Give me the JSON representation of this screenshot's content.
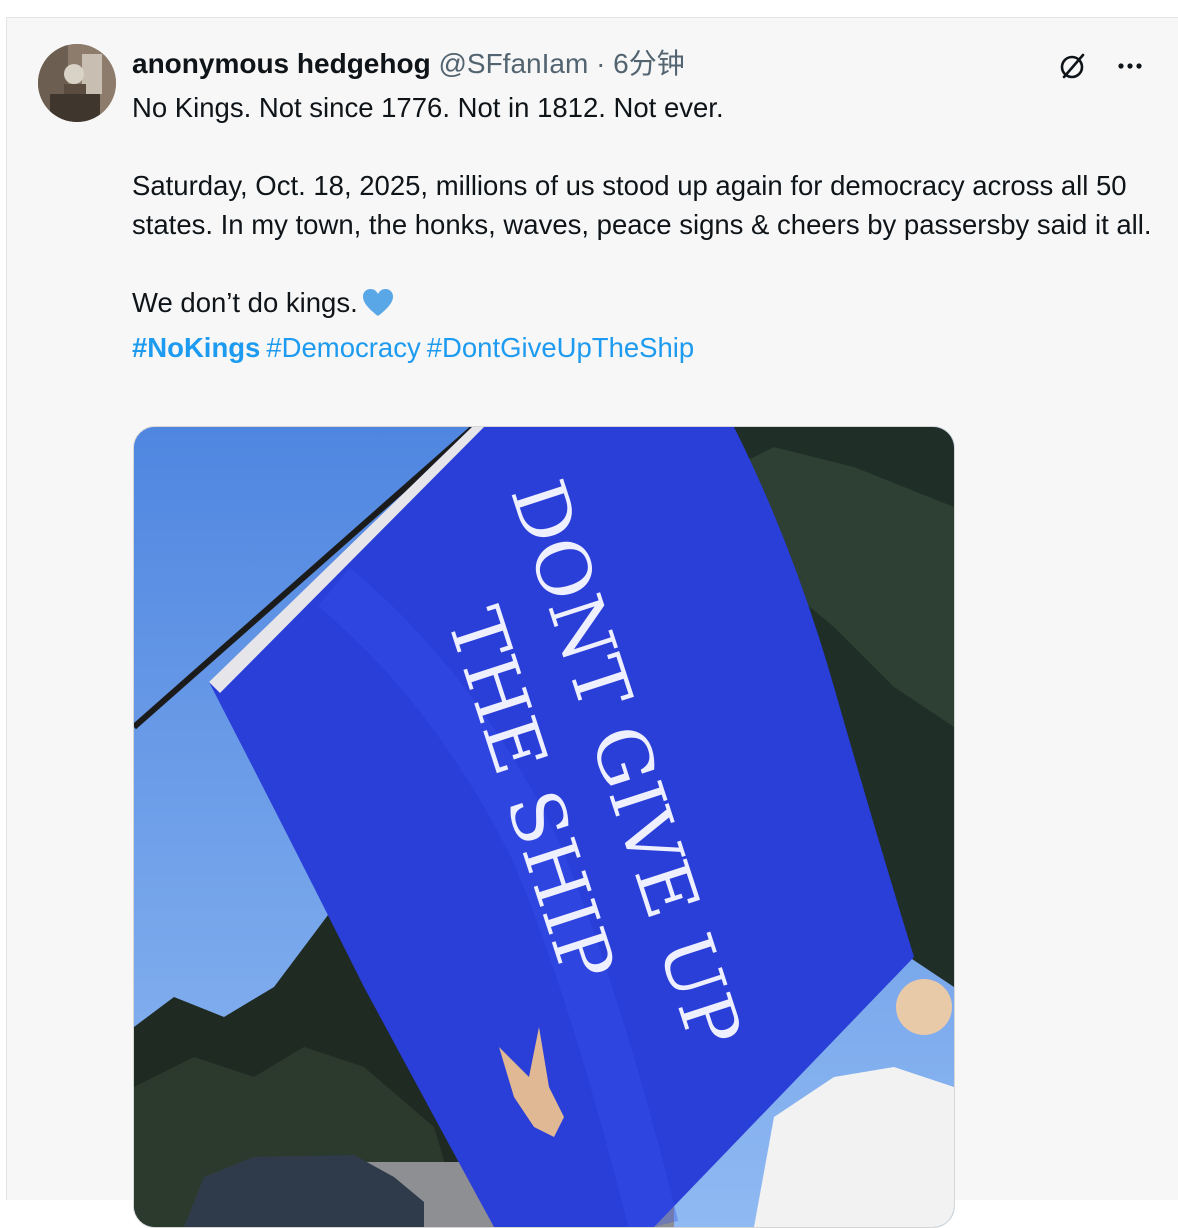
{
  "post": {
    "author": {
      "display_name": "anonymous hedgehog",
      "handle": "@SFfanIam",
      "separator": "·",
      "time": "6分钟"
    },
    "actions": {
      "grok_icon": "grok-slash-circle-icon",
      "more_icon": "more-horizontal-icon"
    },
    "text": {
      "line1": "No Kings. Not since 1776. Not in 1812. Not ever.",
      "paragraph2": "Saturday, Oct. 18, 2025, millions of us stood up again for democracy across all 50 states. In my town, the honks, waves, peace signs & cheers by passersby said it all.",
      "line3": "We don’t do kings."
    },
    "hashtags": [
      "#NoKings",
      "#Democracy",
      "#DontGiveUpTheShip"
    ],
    "media": {
      "flag_text_line1": "DONT GIVE UP",
      "flag_text_line2": "THE SHIP"
    },
    "colors": {
      "link": "#1d9bf0",
      "heart": "#5aa7e8",
      "flag": "#2a3ed8"
    }
  }
}
